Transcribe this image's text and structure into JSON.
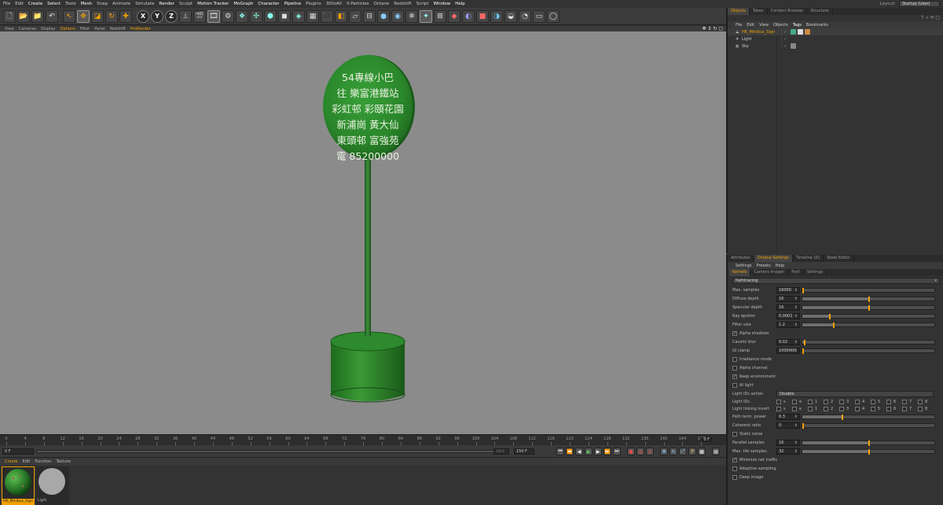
{
  "menubar": {
    "items": [
      "File",
      "Edit",
      "Create",
      "Select",
      "Tools",
      "Mesh",
      "Snap",
      "Animate",
      "Simulate",
      "Render",
      "Sculpt",
      "Motion Tracker",
      "MoGraph",
      "Character",
      "Pipeline",
      "Plugins",
      "3DtoAll",
      "X-Particles",
      "Octane",
      "Redshift",
      "Script",
      "Window",
      "Help"
    ],
    "layout_label": "Layout:",
    "layout_value": "Startup (User)"
  },
  "toolbar": {
    "axis_labels": [
      "X",
      "Y",
      "Z"
    ]
  },
  "viewport": {
    "menu": [
      "View",
      "Cameras",
      "Display",
      "Options",
      "Filter",
      "Panel",
      "Redshift",
      "ProRender"
    ],
    "active_menu": "Options",
    "sign_text_lines": [
      "54專線小巴",
      "往 樂富港鐵站",
      "彩虹邨 彩頤花園",
      "新浦崗 黃大仙",
      "東頭邨 富強苑",
      "電 85200000"
    ],
    "colors": {
      "background": "#8b8b8b",
      "sign_green": "#2f8a2f",
      "sign_text": "#e8f0e0"
    }
  },
  "timeline": {
    "ticks": [
      "0",
      "4",
      "8",
      "12",
      "16",
      "20",
      "24",
      "28",
      "32",
      "36",
      "40",
      "44",
      "48",
      "52",
      "56",
      "60",
      "64",
      "68",
      "72",
      "76",
      "80",
      "84",
      "88",
      "92",
      "96",
      "100",
      "104",
      "108",
      "112",
      "116",
      "120",
      "124",
      "128",
      "132",
      "136",
      "140",
      "144",
      "148"
    ],
    "end_frame": "0 F"
  },
  "transport": {
    "current_frame": "0 F",
    "start_frame": "0 F",
    "min_field": "150 F",
    "max_field": "150 F"
  },
  "material_manager": {
    "menu": [
      "Create",
      "Edit",
      "Function",
      "Texture"
    ],
    "active": "Create",
    "materials": [
      {
        "name": "HK_Minibus_Sign",
        "selected": true
      },
      {
        "name": "Light",
        "selected": false
      }
    ]
  },
  "object_manager": {
    "tabs": [
      "Objects",
      "Takes",
      "Content Browser",
      "Structure"
    ],
    "active_tab": "Objects",
    "menu": [
      "File",
      "Edit",
      "View",
      "Objects",
      "Tags",
      "Bookmarks"
    ],
    "active_menu": "Tags",
    "objects": [
      {
        "name": "HK_Minibus_Sign",
        "selected": true
      },
      {
        "name": "Light",
        "selected": false
      },
      {
        "name": "Sky",
        "selected": false
      }
    ]
  },
  "attributes": {
    "tabs": [
      "Attributes",
      "Octane Settings",
      "Timeline (D)",
      "Node Editor"
    ],
    "active_tab": "Octane Settings",
    "menu": [
      "Settings",
      "Presets",
      "Help"
    ],
    "subtabs": [
      "Kernels",
      "Camera Imager",
      "Post",
      "Settings"
    ],
    "active_subtab": "Kernels",
    "kernel": "Pathtracing",
    "params": [
      {
        "label": "Max. samples",
        "value": "16000",
        "fill": 0
      },
      {
        "label": "Diffuse depth",
        "value": "16",
        "fill": 0.5
      },
      {
        "label": "Specular depth",
        "value": "16",
        "fill": 0.5
      },
      {
        "label": "Ray epsilon",
        "value": "0.0001",
        "fill": 0.2
      },
      {
        "label": "Filter size",
        "value": "1.2",
        "fill": 0.23
      }
    ],
    "alpha_shadows": "Alpha shadows",
    "caustic_blur": {
      "label": "Caustic blur",
      "value": "0.02",
      "fill": 0.01
    },
    "gi_clamp": {
      "label": "GI clamp",
      "value": "1000000"
    },
    "irradiance_mode": "Irradiance mode",
    "alpha_channel": "Alpha channel",
    "keep_environment": "Keep environment",
    "ai_light": "AI light",
    "light_ids_action": {
      "label": "Light IDs action",
      "value": "Disable"
    },
    "light_ids_label": "Light IDs",
    "light_linking_label": "Light linking invert",
    "light_ids": [
      "s",
      "e",
      "1",
      "2",
      "3",
      "4",
      "5",
      "6",
      "7",
      "8"
    ],
    "path_term": {
      "label": "Path term. power",
      "value": "0.3",
      "fill": 0.3
    },
    "coherent_ratio": {
      "label": "Coherent ratio",
      "value": "0",
      "fill": 0
    },
    "static_noise": "Static noise",
    "parallel_samples": {
      "label": "Parallel samples",
      "value": "16",
      "fill": 0.5
    },
    "max_tile_samples": {
      "label": "Max. tile samples",
      "value": "32",
      "fill": 0.5
    },
    "minimize_net": "Minimize net traffic",
    "adaptive_sampling": "Adaptive sampling",
    "deep_image": "Deep image"
  }
}
